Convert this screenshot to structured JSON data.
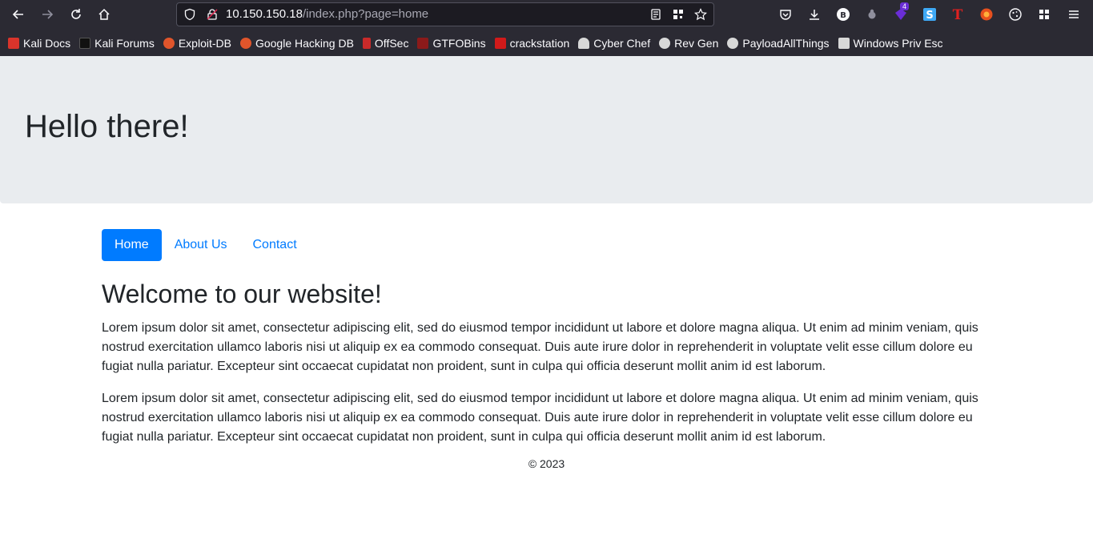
{
  "browser": {
    "url_host": "10.150.150.18",
    "url_path": "/index.php?page=home",
    "extension_badge": "4",
    "bookmarks": [
      {
        "label": "Kali Docs",
        "color": "#d9342b"
      },
      {
        "label": "Kali Forums",
        "color": "#111111"
      },
      {
        "label": "Exploit-DB",
        "color": "#e0552b"
      },
      {
        "label": "Google Hacking DB",
        "color": "#e0552b"
      },
      {
        "label": "OffSec",
        "color": "#c92a2a"
      },
      {
        "label": "GTFOBins",
        "color": "#8b1a1a"
      },
      {
        "label": "crackstation",
        "color": "#d11a1a"
      },
      {
        "label": "Cyber Chef",
        "color": "#d8d8d8"
      },
      {
        "label": "Rev Gen",
        "color": "#d8d8d8"
      },
      {
        "label": "PayloadAllThings",
        "color": "#d8d8d8"
      },
      {
        "label": "Windows Priv Esc",
        "color": "#d8d8d8"
      }
    ]
  },
  "page": {
    "jumbotron_title": "Hello there!",
    "nav": [
      {
        "label": "Home",
        "active": true
      },
      {
        "label": "About Us",
        "active": false
      },
      {
        "label": "Contact",
        "active": false
      }
    ],
    "heading": "Welcome to our website!",
    "paragraphs": [
      "Lorem ipsum dolor sit amet, consectetur adipiscing elit, sed do eiusmod tempor incididunt ut labore et dolore magna aliqua. Ut enim ad minim veniam, quis nostrud exercitation ullamco laboris nisi ut aliquip ex ea commodo consequat. Duis aute irure dolor in reprehenderit in voluptate velit esse cillum dolore eu fugiat nulla pariatur. Excepteur sint occaecat cupidatat non proident, sunt in culpa qui officia deserunt mollit anim id est laborum.",
      "Lorem ipsum dolor sit amet, consectetur adipiscing elit, sed do eiusmod tempor incididunt ut labore et dolore magna aliqua. Ut enim ad minim veniam, quis nostrud exercitation ullamco laboris nisi ut aliquip ex ea commodo consequat. Duis aute irure dolor in reprehenderit in voluptate velit esse cillum dolore eu fugiat nulla pariatur. Excepteur sint occaecat cupidatat non proident, sunt in culpa qui officia deserunt mollit anim id est laborum."
    ],
    "footer": "© 2023"
  },
  "colors": {
    "accent": "#007bff",
    "jumbotron_bg": "#e9ecef",
    "chrome_bg": "#2b2a33"
  }
}
